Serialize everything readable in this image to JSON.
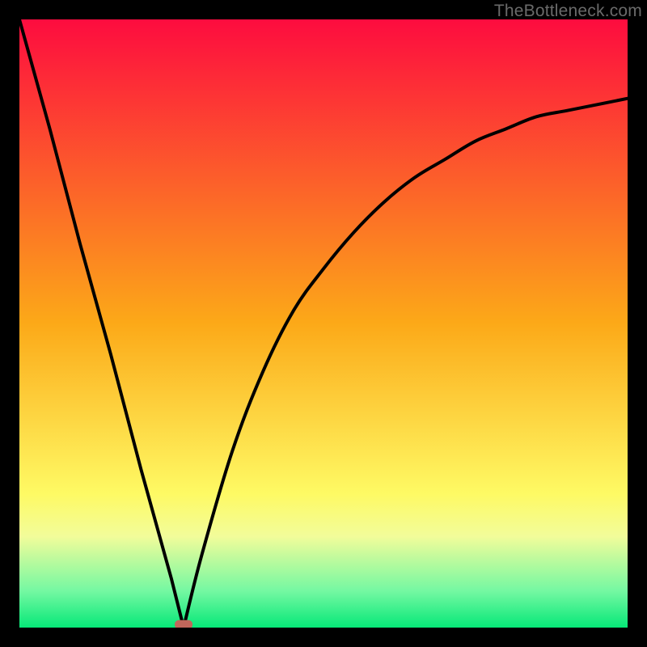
{
  "watermark": "TheBottleneck.com",
  "chart_data": {
    "type": "line",
    "title": "",
    "xlabel": "",
    "ylabel": "",
    "xlim": [
      0,
      100
    ],
    "ylim": [
      0,
      100
    ],
    "background": {
      "type": "vertical-gradient",
      "stops": [
        {
          "y_pct": 0,
          "color": "#fd0c3f"
        },
        {
          "y_pct": 50,
          "color": "#fca918"
        },
        {
          "y_pct": 78,
          "color": "#fefa64"
        },
        {
          "y_pct": 85,
          "color": "#f2fc9a"
        },
        {
          "y_pct": 94,
          "color": "#74f8a2"
        },
        {
          "y_pct": 100,
          "color": "#06e878"
        }
      ]
    },
    "series": [
      {
        "name": "bottleneck-curve",
        "description": "V-shaped curve: steep linear left branch falling to ~0, then rising right branch with decreasing slope",
        "x": [
          0,
          5,
          10,
          15,
          20,
          25,
          27,
          30,
          35,
          40,
          45,
          50,
          55,
          60,
          65,
          70,
          75,
          80,
          85,
          90,
          95,
          100
        ],
        "y": [
          100,
          82,
          63,
          45,
          26,
          8,
          0,
          12,
          29,
          42,
          52,
          59,
          65,
          70,
          74,
          77,
          80,
          82,
          84,
          85,
          86,
          87
        ]
      }
    ],
    "marker": {
      "x": 27,
      "y": 0.5,
      "shape": "rounded-rect",
      "color": "#c1675b"
    }
  }
}
